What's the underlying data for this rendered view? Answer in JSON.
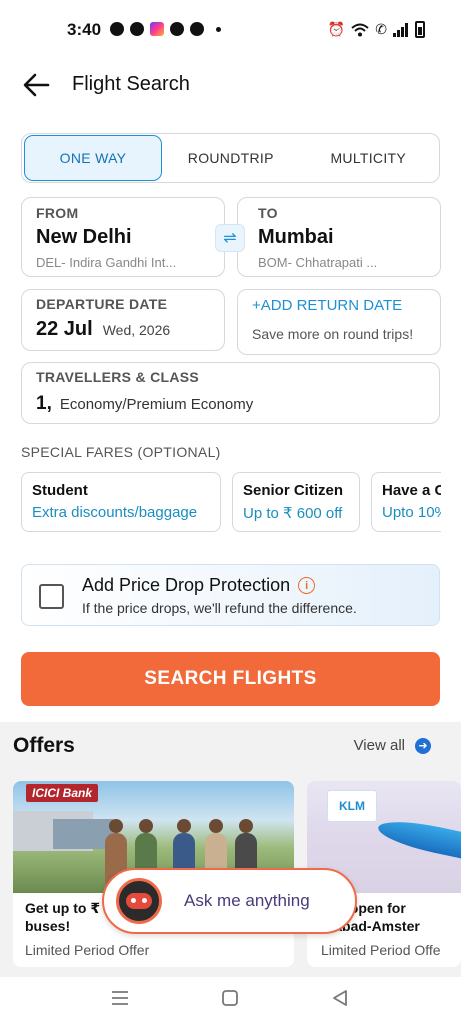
{
  "status": {
    "time": "3:40"
  },
  "header": {
    "title": "Flight Search"
  },
  "trip_tabs": [
    {
      "label": "ONE WAY",
      "active": true
    },
    {
      "label": "ROUNDTRIP",
      "active": false
    },
    {
      "label": "MULTICITY",
      "active": false
    }
  ],
  "from": {
    "label": "FROM",
    "city": "New Delhi",
    "airport": "DEL- Indira Gandhi Int..."
  },
  "to": {
    "label": "TO",
    "city": "Mumbai",
    "airport": "BOM- Chhatrapati ..."
  },
  "departure": {
    "label": "DEPARTURE DATE",
    "date": "22 Jul",
    "weekday": "Wed, 2026"
  },
  "return": {
    "label": "+ADD RETURN DATE",
    "sub": "Save more on round trips!"
  },
  "travellers": {
    "label": "TRAVELLERS & CLASS",
    "count": "1,",
    "class": "Economy/Premium Economy"
  },
  "special_fares": {
    "title": "SPECIAL FARES (OPTIONAL)",
    "items": [
      {
        "title": "Student",
        "sub": "Extra discounts/baggage"
      },
      {
        "title": "Senior Citizen",
        "sub": "Up to ₹ 600 off"
      },
      {
        "title": "Have a C",
        "sub": "Upto 10%"
      }
    ]
  },
  "price_protection": {
    "title": "Add Price Drop Protection",
    "sub": "If the price drops, we'll refund the difference."
  },
  "search_button": "SEARCH FLIGHTS",
  "offers": {
    "title": "Offers",
    "view_all": "View all",
    "cards": [
      {
        "logo": "ICICI Bank",
        "text_line1": "Get up to ₹",
        "text_line2": "buses!",
        "sub": "Limited Period Offer"
      },
      {
        "logo": "KLM",
        "text_line1": "ngs open for",
        "text_line2": "erabad-Amster",
        "sub": "Limited Period Offe"
      }
    ]
  },
  "assistant": {
    "label": "Ask me anything"
  },
  "colors": {
    "accent_blue": "#1f8fd4",
    "cta_orange": "#f26a3a",
    "fare_teal": "#1a8fbf"
  }
}
